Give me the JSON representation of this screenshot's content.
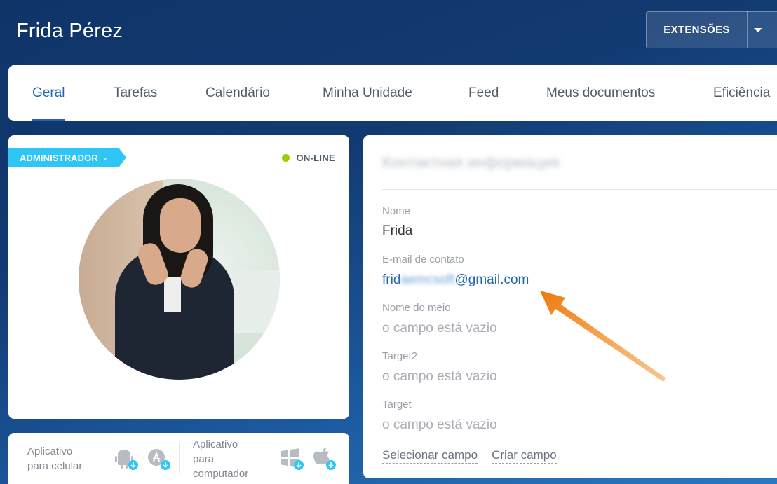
{
  "header": {
    "title": "Frida Pérez",
    "extensions_label": "EXTENSÕES"
  },
  "tabs": [
    {
      "label": "Geral",
      "active": true
    },
    {
      "label": "Tarefas",
      "active": false
    },
    {
      "label": "Calendário",
      "active": false
    },
    {
      "label": "Minha Unidade",
      "active": false
    },
    {
      "label": "Feed",
      "active": false
    },
    {
      "label": "Meus documentos",
      "active": false
    },
    {
      "label": "Eficiência",
      "active": false
    }
  ],
  "profile": {
    "role_badge": "ADMINISTRADOR",
    "status": "ON-LINE",
    "status_color": "#9dcf00"
  },
  "apps": {
    "mobile_label_line1": "Aplicativo",
    "mobile_label_line2": "para celular",
    "desktop_label_line1": "Aplicativo",
    "desktop_label_line2": "para",
    "desktop_label_line3": "computador"
  },
  "contact": {
    "title": "Контактная информация",
    "fields": [
      {
        "label": "Nome",
        "value": "Frida"
      },
      {
        "label": "E-mail de contato",
        "value_prefix": "frid",
        "value_masked": "aemcsoft",
        "value_suffix": "@gmail.com"
      },
      {
        "label": "Nome do meio",
        "value": "o campo está vazio"
      },
      {
        "label": "Target2",
        "value": "o campo está vazio"
      },
      {
        "label": "Target",
        "value": "o campo está vazio"
      }
    ],
    "select_field_link": "Selecionar campo",
    "create_field_link": "Criar campo"
  },
  "colors": {
    "accent": "#2066b0",
    "badge": "#2fc6f6",
    "annotation_arrow": "#f07d0e"
  }
}
